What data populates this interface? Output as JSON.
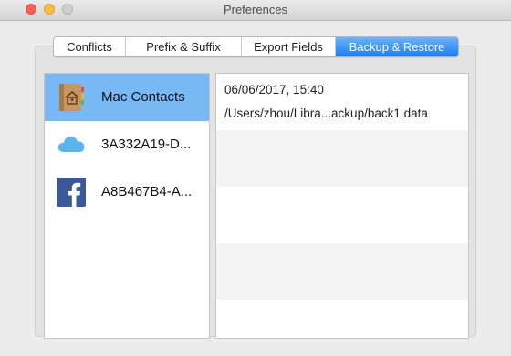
{
  "window": {
    "title": "Preferences"
  },
  "tabs": [
    {
      "label": "Conflicts",
      "active": false
    },
    {
      "label": "Prefix & Suffix",
      "active": false
    },
    {
      "label": "Export Fields",
      "active": false
    },
    {
      "label": "Backup & Restore",
      "active": true
    }
  ],
  "sources": [
    {
      "label": "Mac Contacts",
      "icon": "contacts-app-icon",
      "selected": true
    },
    {
      "label": "3A332A19-D...",
      "icon": "icloud-icon",
      "selected": false
    },
    {
      "label": "A8B467B4-A...",
      "icon": "facebook-icon",
      "selected": false
    }
  ],
  "backup": {
    "date": "06/06/2017, 15:40",
    "path": "/Users/zhou/Libra...ackup/back1.data"
  },
  "colors": {
    "accent": "#1a7ef5",
    "selection": "#78b9f5",
    "icloud": "#5ab4ee",
    "facebook": "#3b5998"
  }
}
